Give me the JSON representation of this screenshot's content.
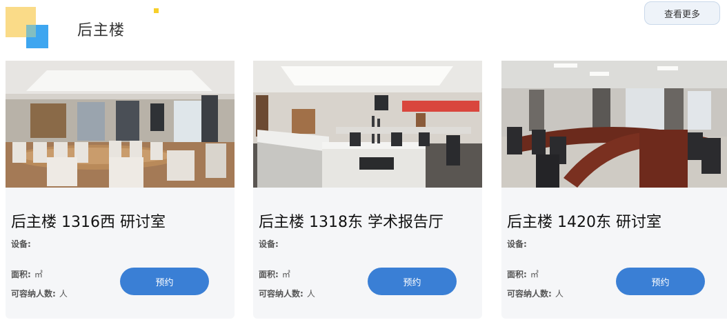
{
  "header": {
    "title": "后主楼",
    "more_label": "查看更多"
  },
  "cards": [
    {
      "name": "后主楼 1316西 研讨室",
      "equipment_label": "设备:",
      "area_label": "面积:",
      "area_unit": "㎡",
      "capacity_label": "可容纳人数:",
      "capacity_unit": "人",
      "book_label": "预约"
    },
    {
      "name": "后主楼 1318东 学术报告厅",
      "equipment_label": "设备:",
      "area_label": "面积:",
      "area_unit": "㎡",
      "capacity_label": "可容纳人数:",
      "capacity_unit": "人",
      "book_label": "预约"
    },
    {
      "name": "后主楼 1420东 研讨室",
      "equipment_label": "设备:",
      "area_label": "面积:",
      "area_unit": "㎡",
      "capacity_label": "可容纳人数:",
      "capacity_unit": "人",
      "book_label": "预约"
    }
  ],
  "colors": {
    "accent": "#3a7fd5",
    "card_bg": "#f5f6f8",
    "logo_yellow": "#f9d77b",
    "logo_blue": "#3ea6f0"
  }
}
